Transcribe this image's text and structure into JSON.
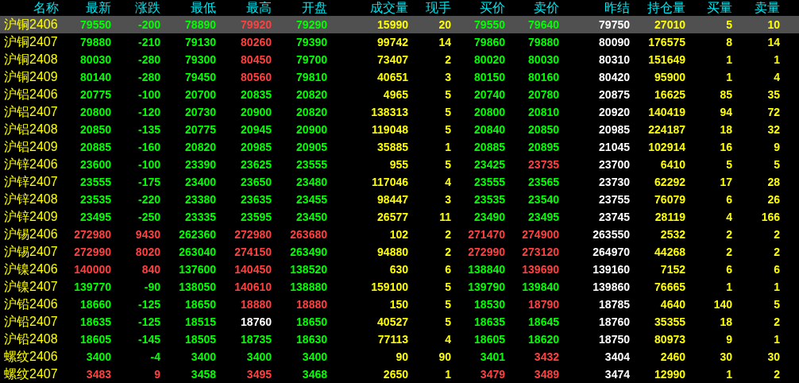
{
  "columns": [
    {
      "label": "名称",
      "kind": "name"
    },
    {
      "label": "最新",
      "kind": "price"
    },
    {
      "label": "涨跌",
      "kind": "change"
    },
    {
      "label": "最低",
      "kind": "price"
    },
    {
      "label": "最高",
      "kind": "price"
    },
    {
      "label": "开盘",
      "kind": "price"
    },
    {
      "label": "成交量",
      "kind": "volume"
    },
    {
      "label": "现手",
      "kind": "volume"
    },
    {
      "label": "买价",
      "kind": "price"
    },
    {
      "label": "卖价",
      "kind": "price"
    },
    {
      "label": "昨结",
      "kind": "reference"
    },
    {
      "label": "持仓量",
      "kind": "volume"
    },
    {
      "label": "买量",
      "kind": "volume"
    },
    {
      "label": "卖量",
      "kind": "volume"
    }
  ],
  "rows": [
    {
      "selected": true,
      "cells": [
        "沪铜2406",
        "79550",
        "-200",
        "78890",
        "79920",
        "79290",
        "15990",
        "20",
        "79550",
        "79640",
        "79750",
        "27010",
        "5",
        "10"
      ]
    },
    {
      "selected": false,
      "cells": [
        "沪铜2407",
        "79880",
        "-210",
        "79130",
        "80260",
        "79390",
        "99742",
        "14",
        "79860",
        "79880",
        "80090",
        "176575",
        "8",
        "14"
      ]
    },
    {
      "selected": false,
      "cells": [
        "沪铜2408",
        "80030",
        "-280",
        "79300",
        "80450",
        "79700",
        "73407",
        "2",
        "80020",
        "80030",
        "80310",
        "151649",
        "1",
        "1"
      ]
    },
    {
      "selected": false,
      "cells": [
        "沪铜2409",
        "80140",
        "-280",
        "79450",
        "80560",
        "79810",
        "40651",
        "3",
        "80150",
        "80160",
        "80420",
        "95900",
        "1",
        "4"
      ]
    },
    {
      "selected": false,
      "cells": [
        "沪铝2406",
        "20775",
        "-100",
        "20700",
        "20835",
        "20820",
        "4965",
        "5",
        "20740",
        "20780",
        "20875",
        "16625",
        "85",
        "35"
      ]
    },
    {
      "selected": false,
      "cells": [
        "沪铝2407",
        "20800",
        "-120",
        "20730",
        "20900",
        "20820",
        "138313",
        "5",
        "20800",
        "20810",
        "20920",
        "140419",
        "94",
        "72"
      ]
    },
    {
      "selected": false,
      "cells": [
        "沪铝2408",
        "20850",
        "-135",
        "20775",
        "20945",
        "20900",
        "119048",
        "5",
        "20840",
        "20850",
        "20985",
        "224187",
        "18",
        "32"
      ]
    },
    {
      "selected": false,
      "cells": [
        "沪铝2409",
        "20885",
        "-160",
        "20820",
        "20985",
        "20905",
        "35885",
        "1",
        "20885",
        "20895",
        "21045",
        "102914",
        "16",
        "9"
      ]
    },
    {
      "selected": false,
      "cells": [
        "沪锌2406",
        "23600",
        "-100",
        "23390",
        "23625",
        "23555",
        "955",
        "5",
        "23425",
        "23735",
        "23700",
        "6410",
        "5",
        "5"
      ]
    },
    {
      "selected": false,
      "cells": [
        "沪锌2407",
        "23555",
        "-175",
        "23400",
        "23650",
        "23480",
        "117046",
        "4",
        "23555",
        "23565",
        "23730",
        "62292",
        "17",
        "28"
      ]
    },
    {
      "selected": false,
      "cells": [
        "沪锌2408",
        "23535",
        "-220",
        "23380",
        "23635",
        "23455",
        "98447",
        "3",
        "23535",
        "23540",
        "23755",
        "76079",
        "6",
        "26"
      ]
    },
    {
      "selected": false,
      "cells": [
        "沪锌2409",
        "23495",
        "-250",
        "23335",
        "23595",
        "23450",
        "26577",
        "11",
        "23490",
        "23495",
        "23745",
        "28119",
        "4",
        "166"
      ]
    },
    {
      "selected": false,
      "cells": [
        "沪锡2406",
        "272980",
        "9430",
        "262360",
        "272980",
        "263680",
        "102",
        "2",
        "271470",
        "274900",
        "263550",
        "2532",
        "2",
        "2"
      ]
    },
    {
      "selected": false,
      "cells": [
        "沪锡2407",
        "272990",
        "8020",
        "263040",
        "274150",
        "263490",
        "94880",
        "2",
        "272990",
        "273120",
        "264970",
        "44268",
        "2",
        "2"
      ]
    },
    {
      "selected": false,
      "cells": [
        "沪镍2406",
        "140000",
        "840",
        "137600",
        "140450",
        "138520",
        "630",
        "6",
        "138840",
        "139690",
        "139160",
        "7152",
        "6",
        "6"
      ]
    },
    {
      "selected": false,
      "cells": [
        "沪镍2407",
        "139770",
        "-90",
        "138050",
        "140610",
        "138880",
        "159100",
        "5",
        "139790",
        "139840",
        "139860",
        "76665",
        "1",
        "1"
      ]
    },
    {
      "selected": false,
      "cells": [
        "沪铅2406",
        "18660",
        "-125",
        "18650",
        "18880",
        "18880",
        "150",
        "5",
        "18530",
        "18790",
        "18785",
        "4640",
        "140",
        "5"
      ]
    },
    {
      "selected": false,
      "cells": [
        "沪铅2407",
        "18635",
        "-125",
        "18515",
        "18760",
        "18650",
        "40527",
        "5",
        "18635",
        "18645",
        "18760",
        "35355",
        "18",
        "2"
      ]
    },
    {
      "selected": false,
      "cells": [
        "沪铅2408",
        "18605",
        "-145",
        "18505",
        "18735",
        "18630",
        "77113",
        "4",
        "18605",
        "18620",
        "18750",
        "80973",
        "9",
        "1"
      ]
    },
    {
      "selected": false,
      "cells": [
        "螺纹2406",
        "3400",
        "-4",
        "3400",
        "3400",
        "3400",
        "90",
        "90",
        "3401",
        "3432",
        "3404",
        "2460",
        "30",
        "30"
      ]
    },
    {
      "selected": false,
      "cells": [
        "螺纹2407",
        "3483",
        "9",
        "3458",
        "3495",
        "3468",
        "2650",
        "1",
        "3479",
        "3489",
        "3474",
        "12990",
        "1",
        "2"
      ]
    }
  ]
}
